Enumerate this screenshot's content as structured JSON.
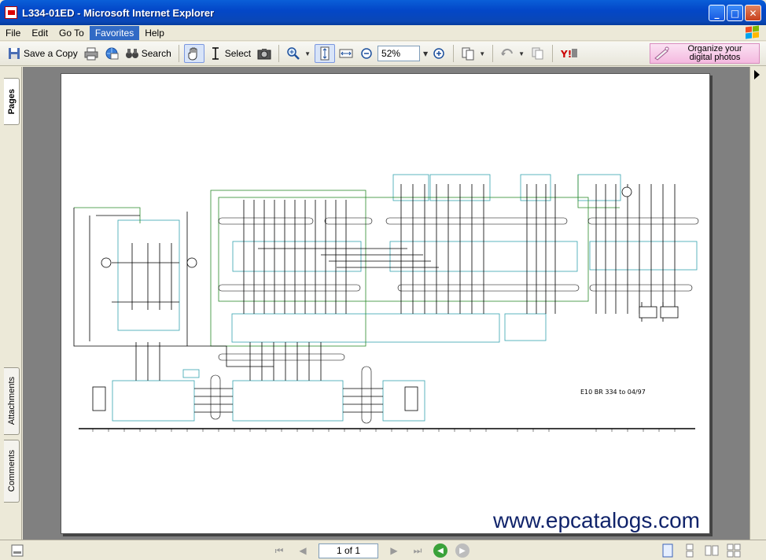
{
  "window": {
    "title": "L334-01ED - Microsoft Internet Explorer",
    "minimize": "_",
    "maximize": "□",
    "close": "✕"
  },
  "menu": [
    {
      "label": "File"
    },
    {
      "label": "Edit"
    },
    {
      "label": "Go To"
    },
    {
      "label": "Favorites",
      "active": true
    },
    {
      "label": "Help"
    }
  ],
  "toolbar": {
    "save_copy": "Save a Copy",
    "search": "Search",
    "select": "Select",
    "zoom": "52%",
    "organize_line1": "Organize your",
    "organize_line2": "digital photos"
  },
  "sidepanel": {
    "pages_tab": "Pages",
    "attachments_tab": "Attachments",
    "comments_tab": "Comments"
  },
  "document": {
    "caption": "E10 BR 334 to 04/97"
  },
  "status": {
    "page_indicator": "1 of 1"
  },
  "watermark": "www.epcatalogs.com",
  "colors": {
    "title_blue": "#0347c8",
    "wire_black": "#000000",
    "wire_green": "#2a8a2a",
    "box_cyan": "#35a3b0"
  }
}
